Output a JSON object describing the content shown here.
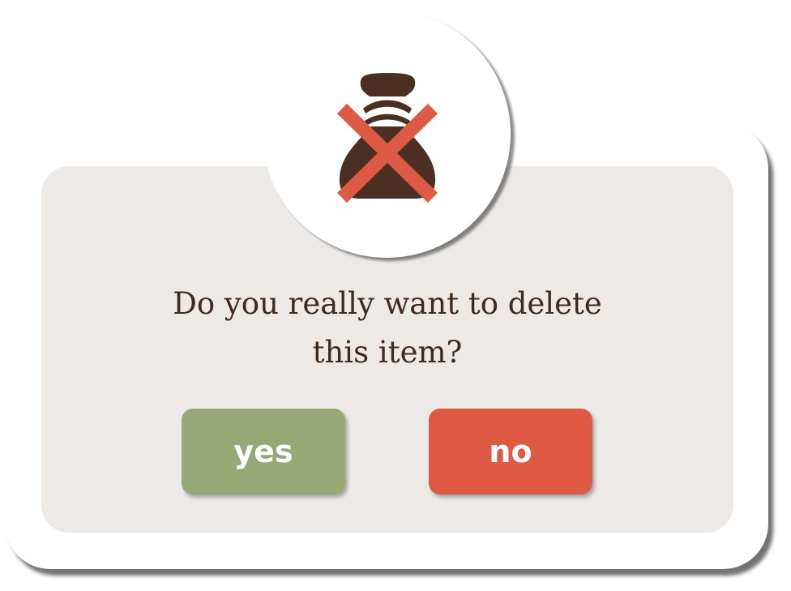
{
  "dialog": {
    "icon": "money-bag-crossed-icon",
    "message_line1": "Do you really want  to delete",
    "message_line2": "this item?",
    "yes_label": "yes",
    "no_label": "no"
  },
  "colors": {
    "panel": "#ece9e6",
    "text": "#3f2a1f",
    "bag": "#4a2f22",
    "cross": "#dd5a45",
    "yes_button": "#97a874",
    "no_button": "#df5a43"
  }
}
